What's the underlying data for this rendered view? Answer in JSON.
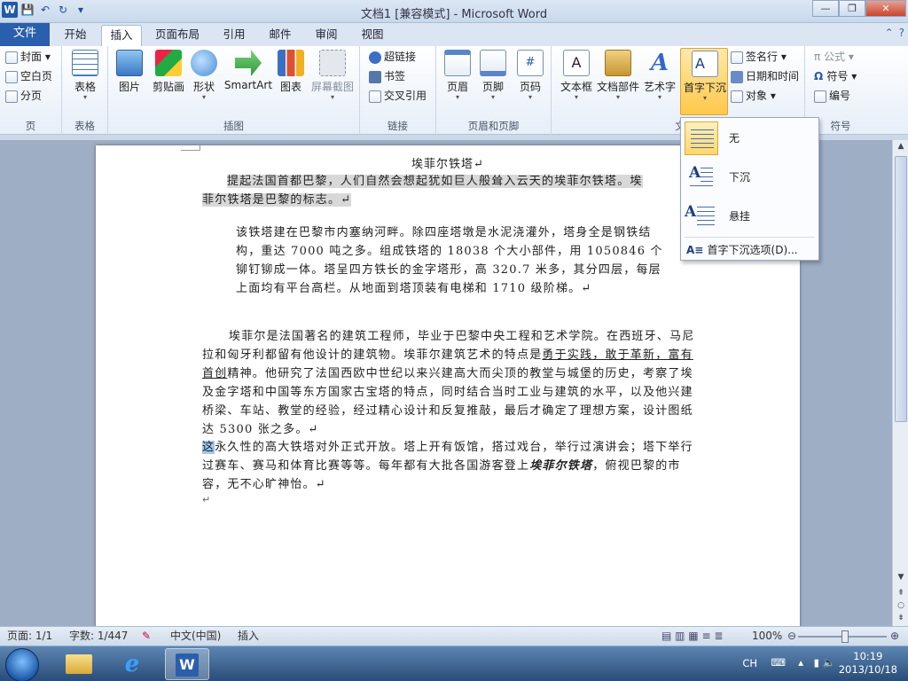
{
  "window": {
    "title": "文档1 [兼容模式] - Microsoft Word"
  },
  "quick_access": {
    "logo": "W",
    "save": "💾",
    "undo": "↶",
    "redo": "↻",
    "customize": "▾"
  },
  "window_buttons": {
    "minimize": "—",
    "restore": "❐",
    "close": "✕"
  },
  "tabs": [
    {
      "label": "文件"
    },
    {
      "label": "开始"
    },
    {
      "label": "插入"
    },
    {
      "label": "页面布局"
    },
    {
      "label": "引用"
    },
    {
      "label": "邮件"
    },
    {
      "label": "审阅"
    },
    {
      "label": "视图"
    }
  ],
  "ribbon": {
    "pages_group": {
      "label": "页",
      "cover": "封面",
      "blank": "空白页",
      "break": "分页"
    },
    "tables_group": {
      "label": "表格",
      "table": "表格"
    },
    "illustrations_group": {
      "label": "插图",
      "picture": "图片",
      "clipart": "剪贴画",
      "shapes": "形状",
      "smartart": "SmartArt",
      "chart": "图表",
      "screenshot": "屏幕截图"
    },
    "links_group": {
      "label": "链接",
      "hyperlink": "超链接",
      "bookmark": "书签",
      "crossref": "交叉引用"
    },
    "headerfooter_group": {
      "label": "页眉和页脚",
      "header": "页眉",
      "footer": "页脚",
      "pagenum": "页码"
    },
    "text_group": {
      "label": "文",
      "textbox": "文本框",
      "quickparts": "文档部件",
      "wordart": "艺术字",
      "dropcap": "首字下沉",
      "signature": "签名行",
      "datetime": "日期和时间",
      "object": "对象"
    },
    "symbols_group": {
      "label": "符号",
      "equation": "公式",
      "symbol": "符号",
      "number": "编号"
    }
  },
  "dropcap_menu": {
    "none": "无",
    "dropped": "下沉",
    "in_margin": "悬挂",
    "options": "首字下沉选项(D)..."
  },
  "document": {
    "title": "埃菲尔铁塔↵",
    "p1_line1": "提起法国首都巴黎，人们自然会想起犹如巨人般耸入云天的埃菲尔铁塔。埃",
    "p1_line2": "菲尔铁塔是巴黎的标志。↵",
    "p2": "该铁塔建在巴黎市内塞纳河畔。除四座塔墩是水泥浇灌外，塔身全是钢铁结构，重达 7000 吨之多。组成铁塔的 18038 个大小部件，用 1050846 个铆钉铆成一体。塔呈四方铁长的金字塔形，高 320.7 米多，其分四层，每层上面均有平台高栏。从地面到塔顶装有电梯和 1710 级阶梯。↵",
    "p3_a": "埃菲尔是法国著名的建筑工程师，毕业于巴黎中央工程和艺术学院。在西班牙、马尼拉和匈牙利都留有他设计的建筑物。埃菲尔建筑艺术的特点是",
    "p3_ul": "勇于实践，敢于革新，富有首创",
    "p3_b": "精神。他研究了法国西欧中世纪以来兴建高大而尖顶的教堂与城堡的历史，考察了埃及金字塔和中国等东方国家古宝塔的特点，同时结合当时工业与建筑的水平，以及他兴建桥梁、车站、教堂的经验，经过精心设计和反复推敲，最后才确定了理想方案，设计图纸达 5300 张之多。↵",
    "p4_sel": "这",
    "p4_a": "永久性的高大铁塔对外正式开放。塔上开有饭馆，搭过戏台，举行过演讲会；塔下举行过赛车、赛马和体育比赛等等。每年都有大批各国游客登上",
    "p4_bi": "埃菲尔铁塔",
    "p4_b": "，俯视巴黎的市容，无不心旷神怡。↵",
    "empty_mark": "↵"
  },
  "statusbar": {
    "page": "页面: 1/1",
    "words": "字数: 1/447",
    "lang": "中文(中国)",
    "mode": "插入",
    "zoom": "100%",
    "zoom_level_percent": 100
  },
  "taskbar": {
    "explorer_icon": "folder-icon",
    "ie_label": "e",
    "word_label": "W",
    "ime": "CH",
    "time": "10:19",
    "date": "2013/10/18"
  }
}
